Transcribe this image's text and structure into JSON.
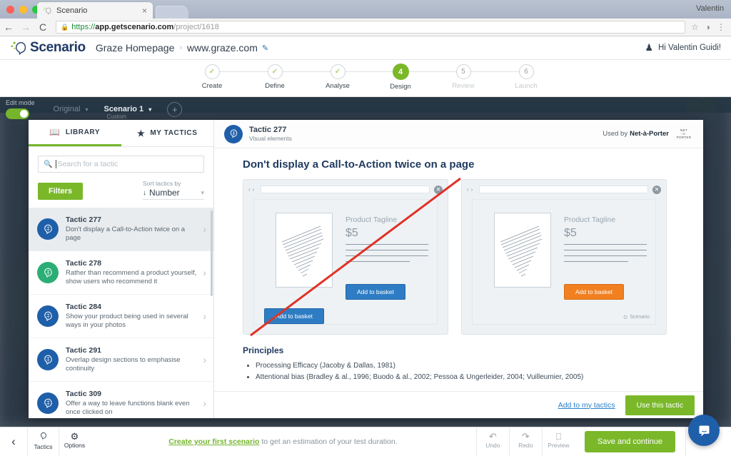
{
  "browser": {
    "tab_title": "Scenario",
    "tab_close": "×",
    "window_user": "Valentin",
    "back_icon": "←",
    "forward_icon": "→",
    "reload_icon": "C",
    "lock_icon": "🔒",
    "url_scheme": "https://",
    "url_host": "app.getscenario.com",
    "url_path": "/project/1618",
    "star_icon": "☆",
    "ext_icon": "◑",
    "menu_icon": "⋮"
  },
  "header": {
    "brand": "Scenario",
    "breadcrumb_project": "Graze Homepage",
    "breadcrumb_sep": "›",
    "breadcrumb_site": "www.graze.com",
    "edit_icon": "✎",
    "user_icon": "⚇",
    "greeting": "Hi Valentin Guidi!"
  },
  "stepper": {
    "steps": [
      {
        "num": "1",
        "label": "Create",
        "state": "done",
        "mark": "✓"
      },
      {
        "num": "2",
        "label": "Define",
        "state": "done",
        "mark": "✓"
      },
      {
        "num": "3",
        "label": "Analyse",
        "state": "done",
        "mark": "✓"
      },
      {
        "num": "4",
        "label": "Design",
        "state": "active",
        "mark": "4"
      },
      {
        "num": "5",
        "label": "Review",
        "state": "future",
        "mark": "5"
      },
      {
        "num": "6",
        "label": "Launch",
        "state": "future",
        "mark": "6"
      }
    ]
  },
  "edit_strip": {
    "edit_mode_label": "Edit mode",
    "toggle_state": "on",
    "original_label": "Original",
    "scenario_label": "Scenario 1",
    "scenario_sub": "Custom",
    "caret": "▾",
    "add_label": "+"
  },
  "library": {
    "tabs": [
      {
        "label": "LIBRARY",
        "icon": "📖",
        "active": true
      },
      {
        "label": "MY TACTICS",
        "icon": "★",
        "active": false
      }
    ],
    "search_placeholder": "Search for a tactic",
    "search_value": "",
    "filters_label": "Filters",
    "sort_label": "Sort tactics by",
    "sort_value": "Number",
    "sort_direction_icon": "↓",
    "tactics": [
      {
        "title": "Tactic 277",
        "desc": "Don't display a Call-to-Action twice on a page",
        "color": "blue",
        "selected": true
      },
      {
        "title": "Tactic 278",
        "desc": "Rather than recommend a product yourself, show users who recommend it",
        "color": "green",
        "selected": false
      },
      {
        "title": "Tactic 284",
        "desc": "Show your product being used in several ways in your photos",
        "color": "blue",
        "selected": false
      },
      {
        "title": "Tactic 291",
        "desc": "Overlap design sections to emphasise continuity",
        "color": "blue",
        "selected": false
      },
      {
        "title": "Tactic 309",
        "desc": "Offer a way to leave functions blank even once clicked on",
        "color": "blue",
        "selected": false
      }
    ]
  },
  "detail": {
    "tactic_id": "Tactic 277",
    "category": "Visual elements",
    "used_by_prefix": "Used by",
    "used_by_brand": "Net-à-Porter",
    "brand_logo_line1": "NET",
    "brand_logo_line2": "-A-",
    "brand_logo_line3": "PORTER",
    "title": "Don't display a Call-to-Action twice on a page",
    "mock_bad": {
      "tagline": "Product Tagline",
      "price": "$5",
      "cta_main": "Add to basket",
      "cta_extra": "Add to basket",
      "close_icon": "✕",
      "prev_icon": "‹",
      "next_icon": "›"
    },
    "mock_good": {
      "tagline": "Product Tagline",
      "price": "$5",
      "cta_main": "Add to basket",
      "close_icon": "✕",
      "prev_icon": "‹",
      "next_icon": "›",
      "watermark": "Scenario"
    },
    "principles_heading": "Principles",
    "principles": [
      "Processing Efficacy (Jacoby & Dallas, 1981)",
      "Attentional bias (Bradley & al., 1996; Buodo & al., 2002; Pessoa & Ungerleider, 2004; Vuilleumier, 2005)"
    ],
    "add_link": "Add to my tactics",
    "use_button": "Use this tactic"
  },
  "bottom_bar": {
    "back_icon": "‹",
    "tactics_label": "Tactics",
    "options_label": "Options",
    "options_icon": "⚙",
    "hint_link": "Create your first scenario",
    "hint_text": " to get an estimation of your test duration.",
    "undo_label": "Undo",
    "undo_icon": "↶",
    "redo_label": "Redo",
    "redo_icon": "↷",
    "preview_label": "Preview",
    "preview_icon": "⎕",
    "save_label": "Save and continue",
    "chat_icon": "▭"
  },
  "colors": {
    "accent_green": "#7ab829",
    "brand_navy": "#1f3864",
    "badge_blue": "#1f5fa9",
    "badge_green": "#2bae76",
    "cta_blue": "#2e7dc4",
    "cta_orange": "#f18021",
    "strike_red": "#e03226"
  }
}
